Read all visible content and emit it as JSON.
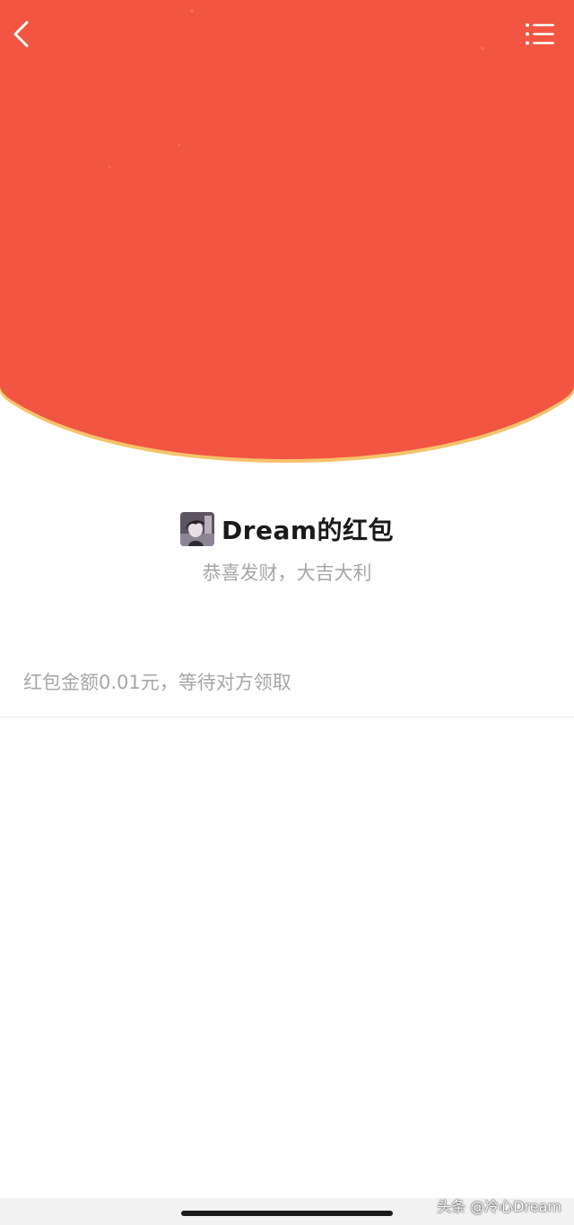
{
  "app": {
    "accent_color": "#f25542",
    "rim_color": "#f6c36a"
  },
  "header": {
    "back_icon": "chevron-left-icon",
    "menu_icon": "list-icon"
  },
  "packet": {
    "sender_title": "Dream的红包",
    "greeting": "恭喜发财，大吉大利",
    "status": "红包金额0.01元，等待对方领取"
  },
  "watermark": "头条 @冷心Dream"
}
